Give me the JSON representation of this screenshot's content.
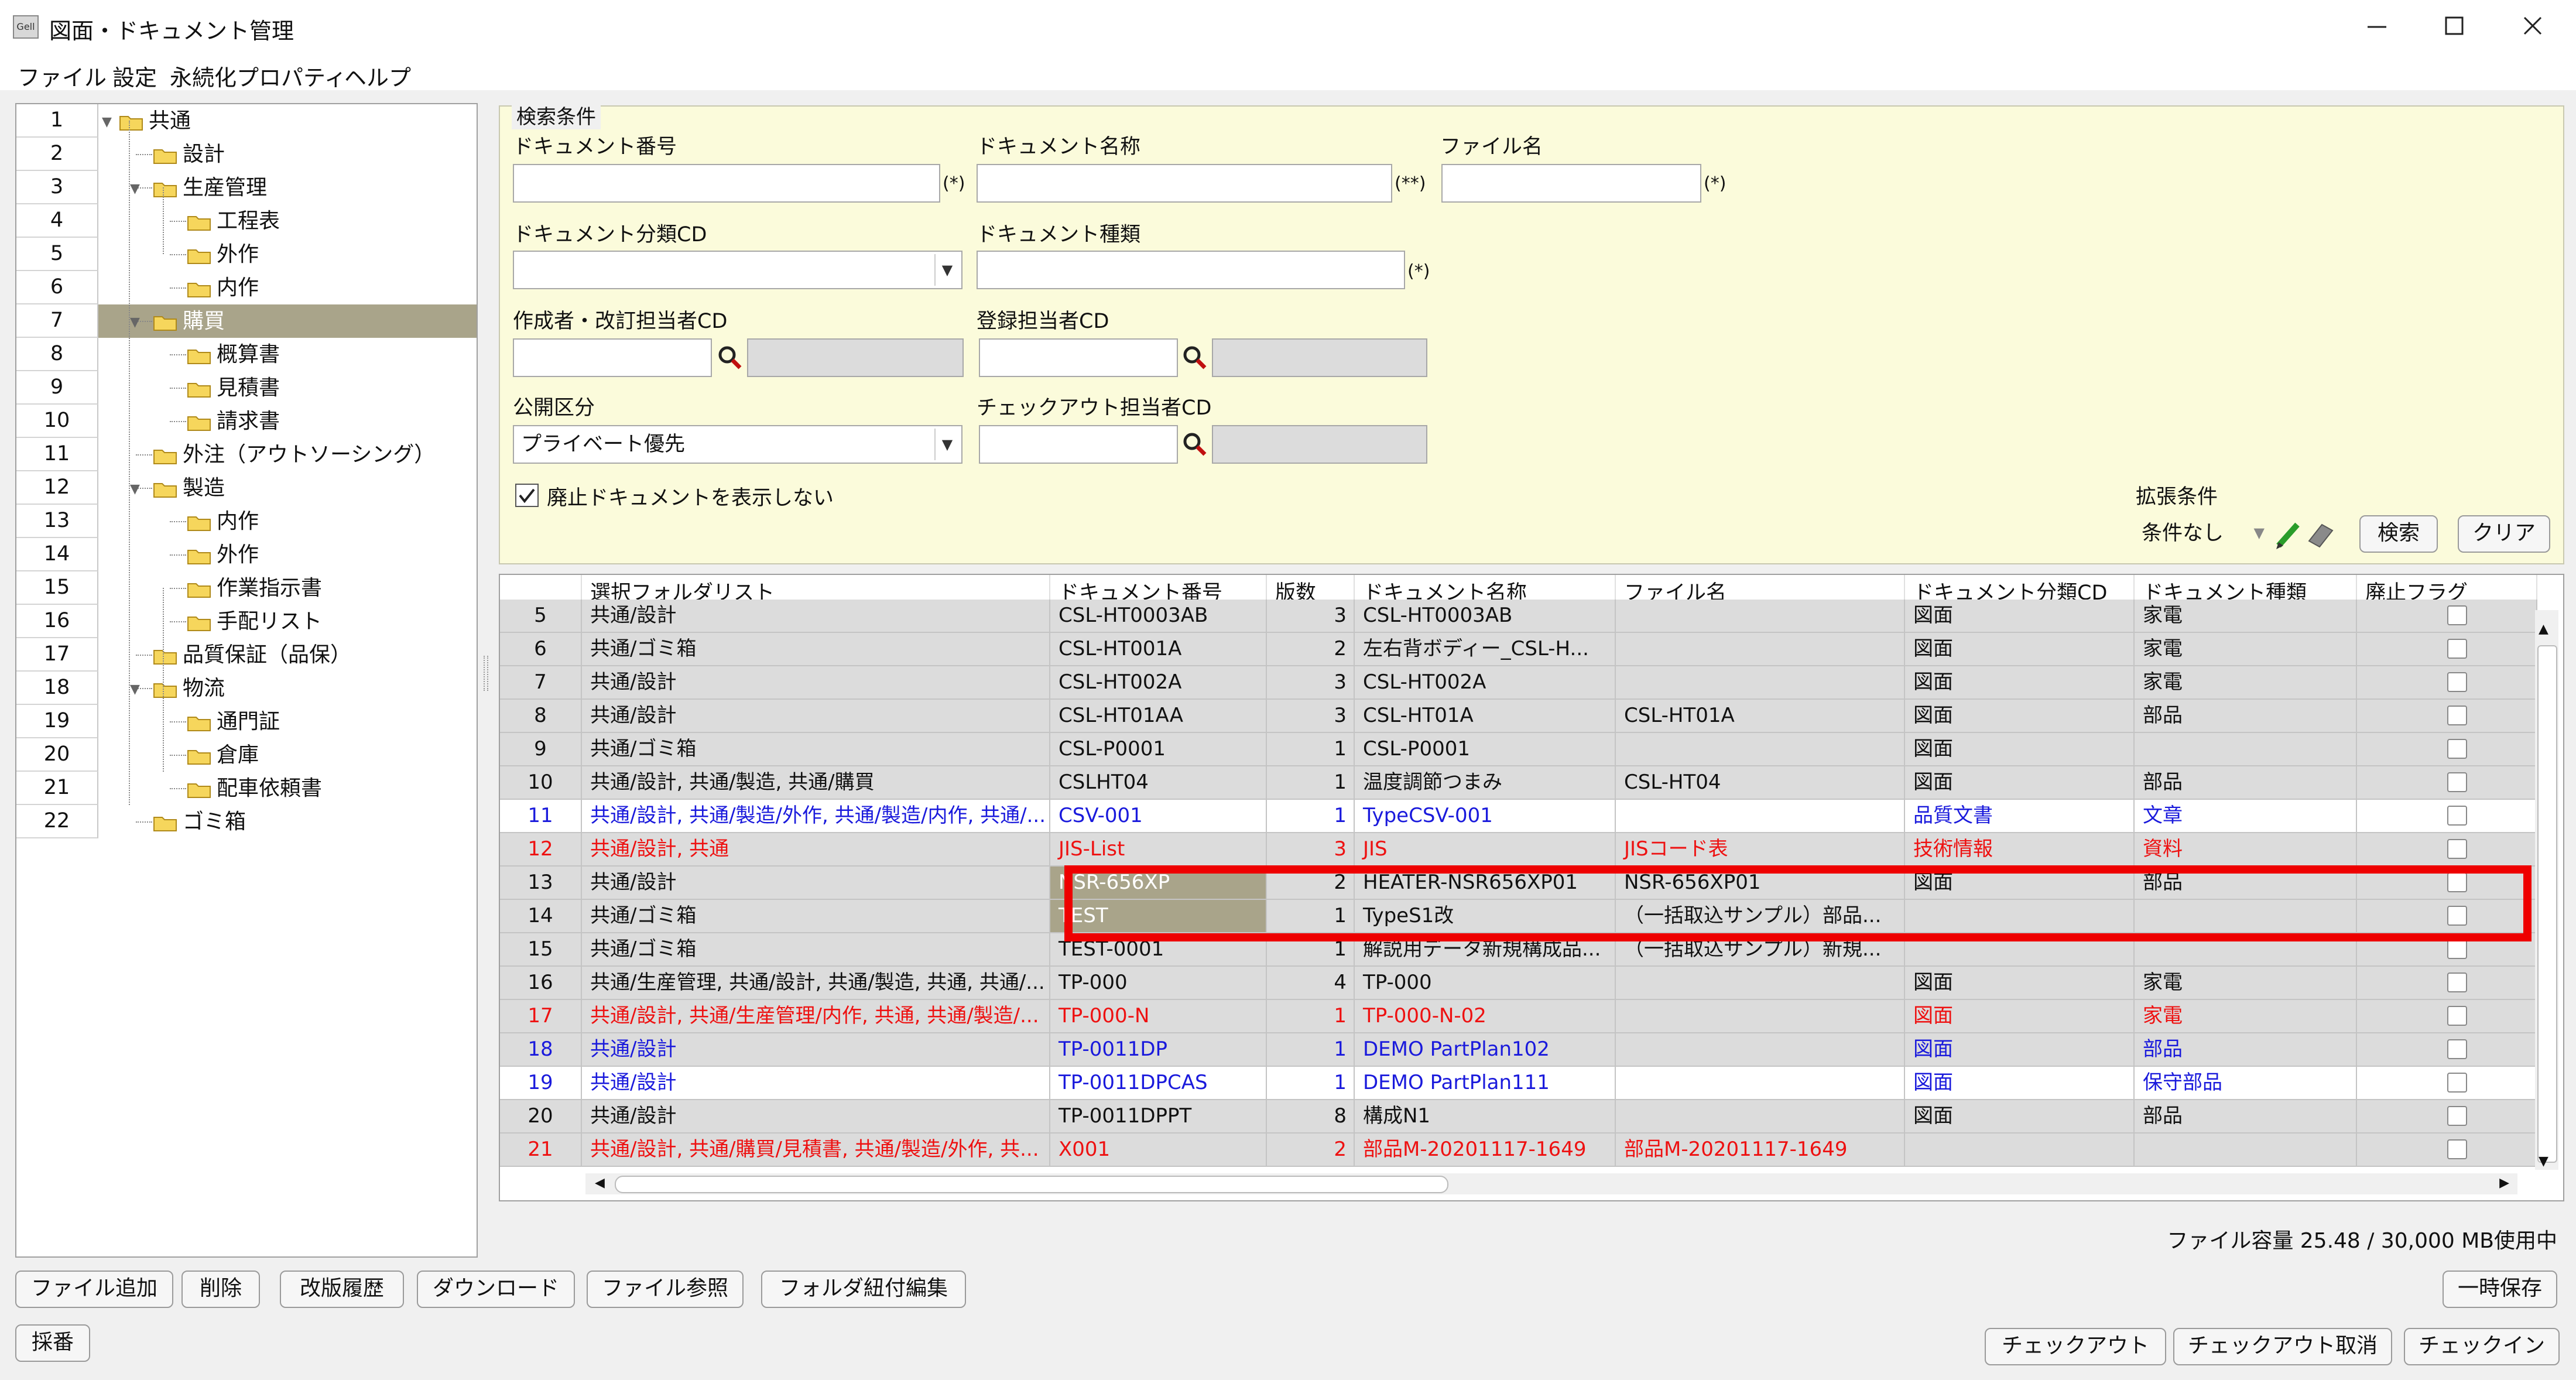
{
  "window": {
    "title": "図面・ドキュメント管理",
    "app_icon": "Gell"
  },
  "menu": [
    "ファイル",
    "設定",
    "永続化プロパティ",
    "ヘルプ"
  ],
  "tree": [
    {
      "num": "1",
      "label": "共通",
      "level": 0
    },
    {
      "num": "2",
      "label": "設計",
      "level": 1
    },
    {
      "num": "3",
      "label": "生産管理",
      "level": 1
    },
    {
      "num": "4",
      "label": "工程表",
      "level": 2
    },
    {
      "num": "5",
      "label": "外作",
      "level": 2
    },
    {
      "num": "6",
      "label": "内作",
      "level": 2
    },
    {
      "num": "7",
      "label": "購買",
      "level": 1
    },
    {
      "num": "8",
      "label": "概算書",
      "level": 2
    },
    {
      "num": "9",
      "label": "見積書",
      "level": 2
    },
    {
      "num": "10",
      "label": "請求書",
      "level": 2
    },
    {
      "num": "11",
      "label": "外注（アウトソーシング）",
      "level": 1
    },
    {
      "num": "12",
      "label": "製造",
      "level": 1
    },
    {
      "num": "13",
      "label": "内作",
      "level": 2
    },
    {
      "num": "14",
      "label": "外作",
      "level": 2
    },
    {
      "num": "15",
      "label": "作業指示書",
      "level": 2
    },
    {
      "num": "16",
      "label": "手配リスト",
      "level": 2
    },
    {
      "num": "17",
      "label": "品質保証（品保）",
      "level": 1
    },
    {
      "num": "18",
      "label": "物流",
      "level": 1
    },
    {
      "num": "19",
      "label": "通門証",
      "level": 2
    },
    {
      "num": "20",
      "label": "倉庫",
      "level": 2
    },
    {
      "num": "21",
      "label": "配車依頼書",
      "level": 2
    },
    {
      "num": "22",
      "label": "ゴミ箱",
      "level": 1
    }
  ],
  "tree_selected": 6,
  "search": {
    "legend": "検索条件",
    "doc_no_label": "ドキュメント番号",
    "doc_no_value": "",
    "doc_no_note": "(*)",
    "doc_name_label": "ドキュメント名称",
    "doc_name_value": "",
    "doc_name_note": "(**)",
    "file_name_label": "ファイル名",
    "file_name_value": "",
    "file_name_note": "(*)",
    "doc_class_label": "ドキュメント分類CD",
    "doc_class_value": "",
    "doc_type_label": "ドキュメント種類",
    "doc_type_value": "",
    "doc_type_note": "(*)",
    "author_label": "作成者・改訂担当者CD",
    "author_value": "",
    "registrar_label": "登録担当者CD",
    "registrar_value": "",
    "visibility_label": "公開区分",
    "visibility_value": "プライベート優先",
    "checkout_label": "チェックアウト担当者CD",
    "checkout_value": "",
    "hide_obsolete_label": "廃止ドキュメントを表示しない",
    "hide_obsolete_checked": true,
    "ext_label": "拡張条件",
    "ext_value": "条件なし",
    "search_button": "検索",
    "clear_button": "クリア"
  },
  "table": {
    "columns": [
      "",
      "選択フォルダリスト",
      "ドキュメント番号",
      "版数",
      "ドキュメント名称",
      "ファイル名",
      "ドキュメント分類CD",
      "ドキュメント種類",
      "廃止フラグ"
    ],
    "rows": [
      {
        "no": "5",
        "folders": "共通/設計",
        "doc_no": "CSL-HT0003AB",
        "ver": "3",
        "name": "CSL-HT0003AB",
        "file": "",
        "cls": "図面",
        "type": "家電",
        "style": "normal"
      },
      {
        "no": "6",
        "folders": "共通/ゴミ箱",
        "doc_no": "CSL-HT001A",
        "ver": "2",
        "name": "左右背ボディー_CSL-H...",
        "file": "",
        "cls": "図面",
        "type": "家電",
        "style": "normal"
      },
      {
        "no": "7",
        "folders": "共通/設計",
        "doc_no": "CSL-HT002A",
        "ver": "3",
        "name": "CSL-HT002A",
        "file": "",
        "cls": "図面",
        "type": "家電",
        "style": "normal"
      },
      {
        "no": "8",
        "folders": "共通/設計",
        "doc_no": "CSL-HT01AA",
        "ver": "3",
        "name": "CSL-HT01A",
        "file": "CSL-HT01A",
        "cls": "図面",
        "type": "部品",
        "style": "normal"
      },
      {
        "no": "9",
        "folders": "共通/ゴミ箱",
        "doc_no": "CSL-P0001",
        "ver": "1",
        "name": "CSL-P0001",
        "file": "",
        "cls": "図面",
        "type": "",
        "style": "normal"
      },
      {
        "no": "10",
        "folders": "共通/設計, 共通/製造, 共通/購買",
        "doc_no": "CSLHT04",
        "ver": "1",
        "name": "温度調節つまみ",
        "file": "CSL-HT04",
        "cls": "図面",
        "type": "部品",
        "style": "normal"
      },
      {
        "no": "11",
        "folders": "共通/設計, 共通/製造/外作, 共通/製造/内作, 共通/...",
        "doc_no": "CSV-001",
        "ver": "1",
        "name": "TypeCSV-001",
        "file": "",
        "cls": "品質文書",
        "type": "文章",
        "style": "blue-white"
      },
      {
        "no": "12",
        "folders": "共通/設計, 共通",
        "doc_no": "JIS-List",
        "ver": "3",
        "name": "JIS",
        "file": "JISコード表",
        "cls": "技術情報",
        "type": "資料",
        "style": "red"
      },
      {
        "no": "13",
        "folders": "共通/設計",
        "doc_no": "NSR-656XP",
        "ver": "2",
        "name": "HEATER-NSR656XP01",
        "file": "NSR-656XP01",
        "cls": "図面",
        "type": "部品",
        "style": "hl"
      },
      {
        "no": "14",
        "folders": "共通/ゴミ箱",
        "doc_no": "TEST",
        "ver": "1",
        "name": "TypeS1改",
        "file": "（一括取込サンプル）部品...",
        "cls": "",
        "type": "",
        "style": "hl"
      },
      {
        "no": "15",
        "folders": "共通/ゴミ箱",
        "doc_no": "TEST-0001",
        "ver": "1",
        "name": "解説用データ新規構成品...",
        "file": "（一括取込サンプル）新規...",
        "cls": "",
        "type": "",
        "style": "normal"
      },
      {
        "no": "16",
        "folders": "共通/生産管理, 共通/設計, 共通/製造, 共通, 共通/...",
        "doc_no": "TP-000",
        "ver": "4",
        "name": "TP-000",
        "file": "",
        "cls": "図面",
        "type": "家電",
        "style": "normal"
      },
      {
        "no": "17",
        "folders": "共通/設計, 共通/生産管理/内作, 共通, 共通/製造/...",
        "doc_no": "TP-000-N",
        "ver": "1",
        "name": "TP-000-N-02",
        "file": "",
        "cls": "図面",
        "type": "家電",
        "style": "red"
      },
      {
        "no": "18",
        "folders": "共通/設計",
        "doc_no": "TP-0011DP",
        "ver": "1",
        "name": "DEMO PartPlan102",
        "file": "",
        "cls": "図面",
        "type": "部品",
        "style": "blue"
      },
      {
        "no": "19",
        "folders": "共通/設計",
        "doc_no": "TP-0011DPCAS",
        "ver": "1",
        "name": "DEMO PartPlan111",
        "file": "",
        "cls": "図面",
        "type": "保守部品",
        "style": "blue-white"
      },
      {
        "no": "20",
        "folders": "共通/設計",
        "doc_no": "TP-0011DPPT",
        "ver": "8",
        "name": "構成N1",
        "file": "",
        "cls": "図面",
        "type": "部品",
        "style": "normal"
      },
      {
        "no": "21",
        "folders": "共通/設計, 共通/購買/見積書, 共通/製造/外作, 共...",
        "doc_no": "X001",
        "ver": "2",
        "name": "部品M-20201117-1649",
        "file": "部品M-20201117-1649",
        "cls": "",
        "type": "",
        "style": "red"
      }
    ]
  },
  "file_capacity": "ファイル容量 25.48 / 30,000 MB使用中",
  "buttons": {
    "add_file": "ファイル追加",
    "delete": "削除",
    "revision_history": "改版履歴",
    "download": "ダウンロード",
    "file_ref": "ファイル参照",
    "folder_link_edit": "フォルダ紐付編集",
    "temp_save": "一時保存",
    "numbering": "採番",
    "checkout": "チェックアウト",
    "checkout_cancel": "チェックアウト取消",
    "checkin": "チェックイン"
  },
  "colors": {
    "selection": "#a9a48a",
    "highlight_box": "#ee0000",
    "search_bg": "#fbfbdb",
    "blue_text": "#1a1adc",
    "red_text": "#ee1111"
  }
}
